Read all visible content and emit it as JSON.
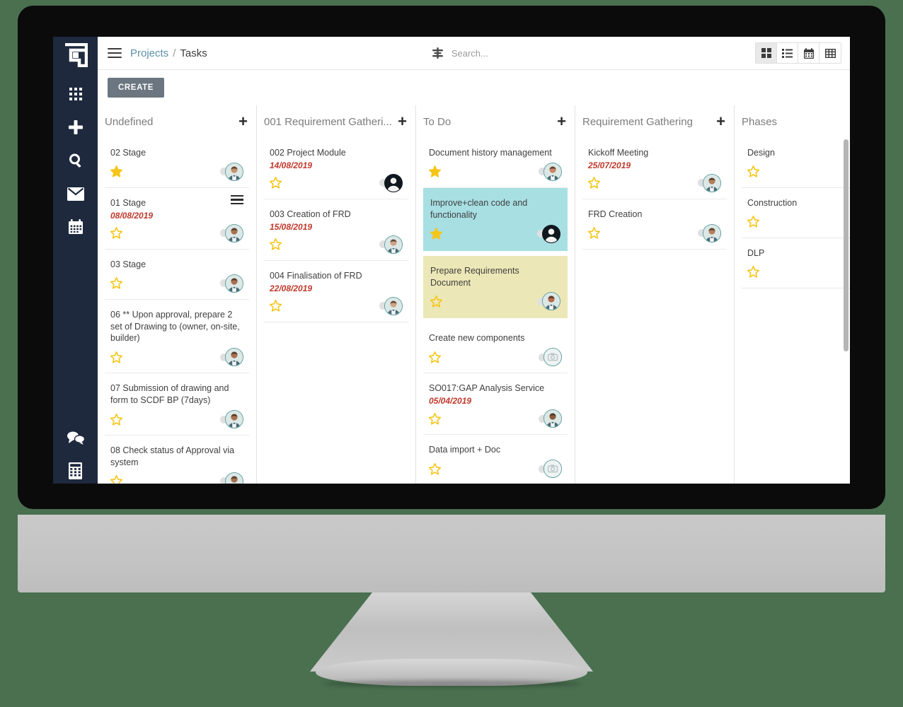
{
  "window": {
    "device": "desktop-monitor",
    "background_color": "#4a7050"
  },
  "rail": {
    "logo_name": "app-logo",
    "items": [
      {
        "icon": "apps-grid-icon",
        "label": "Apps"
      },
      {
        "icon": "plus-icon",
        "label": "Add"
      },
      {
        "icon": "search-icon",
        "label": "Search"
      },
      {
        "icon": "mail-icon",
        "label": "Mail"
      },
      {
        "icon": "calendar-icon",
        "label": "Calendar"
      }
    ],
    "bottom_items": [
      {
        "icon": "chat-icon",
        "label": "Chat"
      },
      {
        "icon": "calculator-icon",
        "label": "Calculator"
      }
    ]
  },
  "topbar": {
    "menu_icon": "hamburger-menu-icon",
    "breadcrumb": {
      "parent": "Projects",
      "separator": "/",
      "current": "Tasks"
    },
    "search": {
      "icon": "filter-icon",
      "placeholder": "Search...",
      "value": ""
    },
    "views": [
      {
        "icon": "grid-view-icon",
        "label": "Kanban",
        "active": true
      },
      {
        "icon": "list-view-icon",
        "label": "List",
        "active": false
      },
      {
        "icon": "calendar-view-icon",
        "label": "Calendar",
        "active": false
      },
      {
        "icon": "table-view-icon",
        "label": "Table",
        "active": false
      }
    ]
  },
  "toolbar": {
    "create_label": "CREATE"
  },
  "board": {
    "add_glyph": "+",
    "columns": [
      {
        "title": "Undefined",
        "has_add": true,
        "cards": [
          {
            "title": "02 Stage",
            "date": "",
            "starred": true,
            "avatar": "photo-male-1",
            "tint": "",
            "menu": false
          },
          {
            "title": "01 Stage",
            "date": "08/08/2019",
            "starred": false,
            "avatar": "photo-male-2",
            "tint": "",
            "menu": true
          },
          {
            "title": "03 Stage",
            "date": "",
            "starred": false,
            "avatar": "photo-male-2",
            "tint": "",
            "menu": false
          },
          {
            "title": "06 ** Upon approval, prepare 2 set of Drawing to (owner, on-site, builder)",
            "date": "",
            "starred": false,
            "avatar": "photo-male-2",
            "tint": "",
            "menu": false
          },
          {
            "title": "07 Submission of drawing and form to SCDF BP (7days)",
            "date": "",
            "starred": false,
            "avatar": "photo-male-2",
            "tint": "",
            "menu": false
          },
          {
            "title": "08 Check status of Approval via system",
            "date": "",
            "starred": false,
            "avatar": "photo-male-2",
            "tint": "",
            "menu": false
          }
        ]
      },
      {
        "title": "001 Requirement Gatheri...",
        "has_add": true,
        "cards": [
          {
            "title": "002 Project Module",
            "date": "14/08/2019",
            "starred": false,
            "avatar": "silhouette-dark",
            "tint": "",
            "menu": false
          },
          {
            "title": "003 Creation of FRD",
            "date": "15/08/2019",
            "starred": false,
            "avatar": "photo-male-3",
            "tint": "",
            "menu": false
          },
          {
            "title": "004 Finalisation of FRD",
            "date": "22/08/2019",
            "starred": false,
            "avatar": "photo-male-3",
            "tint": "",
            "menu": false
          }
        ]
      },
      {
        "title": "To Do",
        "has_add": true,
        "cards": [
          {
            "title": "Document history management",
            "date": "",
            "starred": true,
            "avatar": "photo-female-1",
            "tint": "",
            "menu": false
          },
          {
            "title": "Improve+clean code and functionality",
            "date": "",
            "starred": true,
            "avatar": "silhouette-dark",
            "tint": "#a8dfe3",
            "menu": false
          },
          {
            "title": "Prepare Requirements Document",
            "date": "",
            "starred": false,
            "avatar": "photo-female-2",
            "tint": "#ece7b6",
            "menu": false
          },
          {
            "title": "Create new components",
            "date": "",
            "starred": false,
            "avatar": "camera-placeholder",
            "tint": "",
            "menu": false
          },
          {
            "title": "SO017:GAP Analysis Service",
            "date": "05/04/2019",
            "starred": false,
            "avatar": "photo-male-4",
            "tint": "",
            "menu": false
          },
          {
            "title": "Data import + Doc",
            "date": "",
            "starred": false,
            "avatar": "camera-placeholder",
            "tint": "",
            "menu": false
          }
        ]
      },
      {
        "title": "Requirement Gathering",
        "has_add": true,
        "cards": [
          {
            "title": "Kickoff Meeting",
            "date": "25/07/2019",
            "starred": false,
            "avatar": "photo-male-5",
            "tint": "",
            "menu": false
          },
          {
            "title": "FRD Creation",
            "date": "",
            "starred": false,
            "avatar": "photo-male-5",
            "tint": "",
            "menu": false
          }
        ]
      },
      {
        "title": "Phases",
        "has_add": false,
        "cards": [
          {
            "title": "Design",
            "date": "",
            "starred": false,
            "avatar": "",
            "tint": "",
            "menu": false
          },
          {
            "title": "Construction",
            "date": "",
            "starred": false,
            "avatar": "",
            "tint": "",
            "menu": false
          },
          {
            "title": "DLP",
            "date": "",
            "starred": false,
            "avatar": "",
            "tint": "",
            "menu": false
          }
        ]
      }
    ]
  },
  "colors": {
    "rail_bg": "#1e293e",
    "accent_link": "#5b8fa8",
    "create_btn": "#6b7680",
    "date_text": "#c0392b",
    "star_fill": "#f5c518",
    "tint_cyan": "#a8dfe3",
    "tint_yellow": "#ece7b6"
  }
}
